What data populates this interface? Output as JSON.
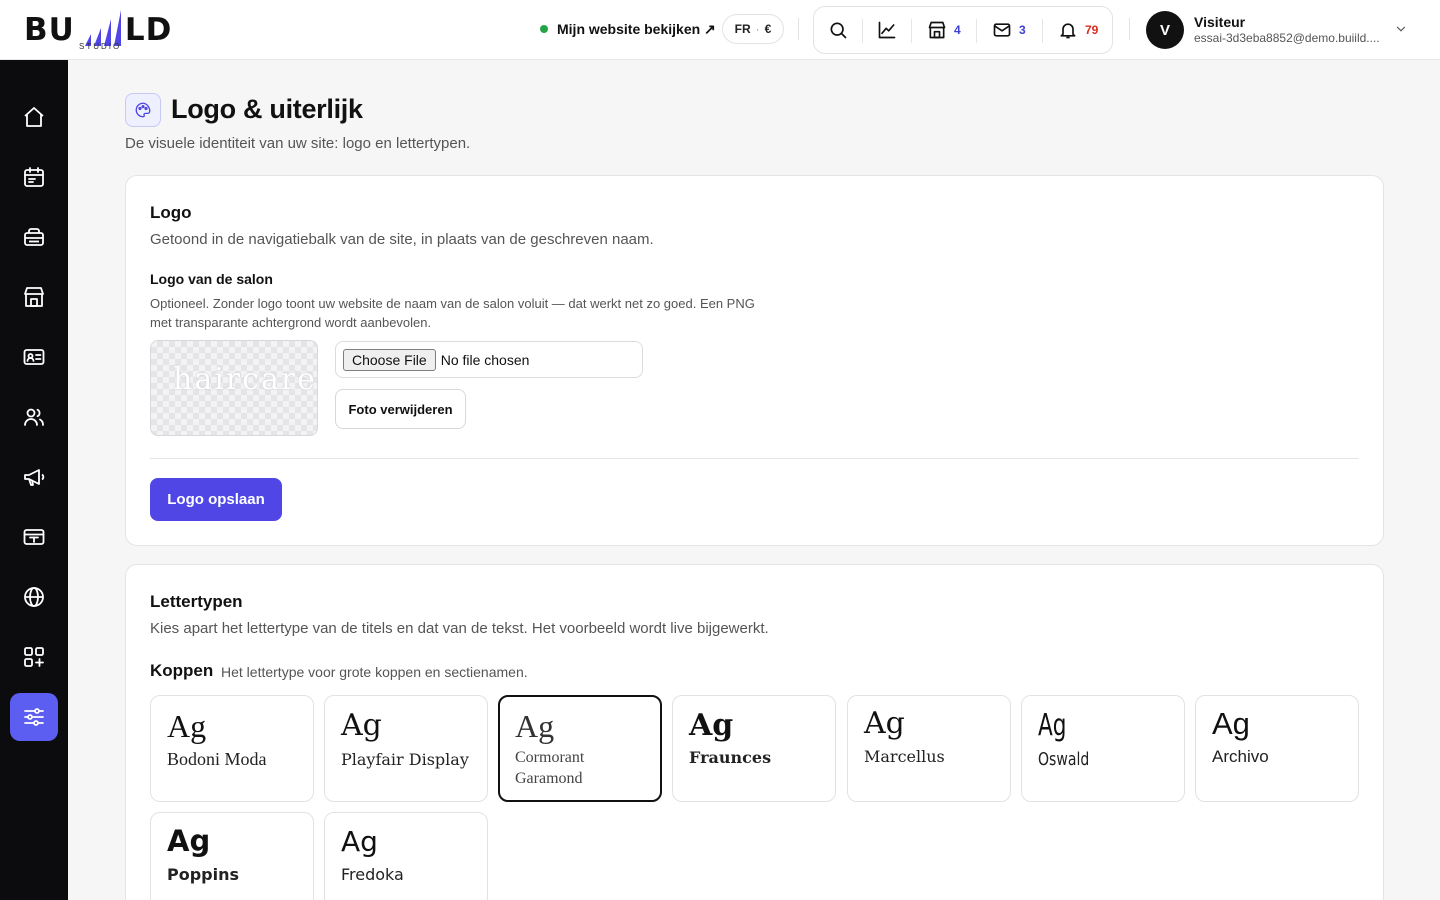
{
  "brand": {
    "wordmark_left": "BU",
    "wordmark_right": "LD",
    "subtitle": "STUDIO"
  },
  "topbar": {
    "site_link": "Mijn website bekijken ↗",
    "lang": "FR",
    "lang_sep": "·",
    "currency": "€",
    "tools": {
      "search_icon": "search-icon",
      "stats_icon": "chart-icon",
      "salons_count": "4",
      "messages_count": "3",
      "notifications_count": "79"
    },
    "user": {
      "initial": "V",
      "name": "Visiteur",
      "email": "essai-3d3eba8852@demo.buiild...."
    },
    "colors": {
      "accent": "#4f46e5",
      "online": "#22a447",
      "count_blue": "#3b3fd6",
      "count_red": "#d92d20"
    }
  },
  "sidebar": {
    "items": [
      {
        "name": "home-icon"
      },
      {
        "name": "calendar-icon"
      },
      {
        "name": "services-icon"
      },
      {
        "name": "store-icon"
      },
      {
        "name": "contact-card-icon"
      },
      {
        "name": "users-icon"
      },
      {
        "name": "megaphone-icon"
      },
      {
        "name": "payment-card-icon"
      },
      {
        "name": "globe-icon"
      },
      {
        "name": "apps-icon"
      },
      {
        "name": "settings-sliders-icon",
        "active": true
      }
    ]
  },
  "page": {
    "title": "Logo & uiterlijk",
    "subtitle": "De visuele identiteit van uw site: logo en lettertypen."
  },
  "logo_section": {
    "title": "Logo",
    "subtitle": "Getoond in de navigatiebalk van de site, in plaats van de geschreven naam.",
    "field_label": "Logo van de salon",
    "field_help": "Optioneel. Zonder logo toont uw website de naam van de salon voluit — dat werkt net zo goed. Een PNG met transparante achtergrond wordt aanbevolen.",
    "preview_text": "haircare",
    "choose_file": "Choose File",
    "no_file": "No file chosen",
    "remove_button": "Foto verwijderen",
    "save_button": "Logo opslaan"
  },
  "fonts_section": {
    "title": "Lettertypen",
    "subtitle": "Kies apart het lettertype van de titels en dat van de tekst. Het voorbeeld wordt live bijgewerkt.",
    "headings_label": "Koppen",
    "headings_help": "Het lettertype voor grote koppen en sectienamen.",
    "sample": "Ag",
    "fonts": [
      {
        "name": "Bodoni Moda"
      },
      {
        "name": "Playfair Display"
      },
      {
        "name": "Cormorant Garamond",
        "selected": true
      },
      {
        "name": "Fraunces"
      },
      {
        "name": "Marcellus"
      },
      {
        "name": "Oswald"
      },
      {
        "name": "Archivo"
      },
      {
        "name": "Poppins"
      },
      {
        "name": "Fredoka"
      }
    ]
  }
}
